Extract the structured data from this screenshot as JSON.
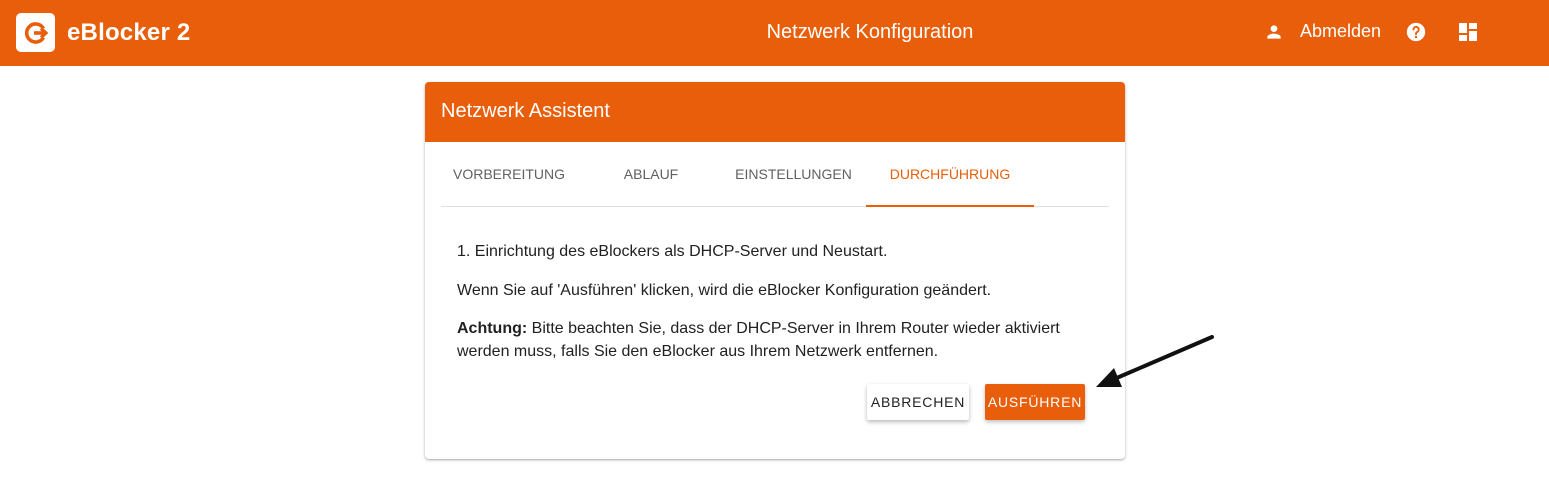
{
  "header": {
    "brand": "eBlocker 2",
    "title": "Netzwerk Konfiguration",
    "logout_label": "Abmelden",
    "icons": [
      "eblocker-logo-icon",
      "user-icon",
      "help-icon",
      "dashboard-icon"
    ],
    "color": "#e95e0a"
  },
  "card": {
    "title": "Netzwerk Assistent",
    "tabs": [
      {
        "label": "VORBEREITUNG",
        "active": false
      },
      {
        "label": "ABLAUF",
        "active": false
      },
      {
        "label": "EINSTELLUNGEN",
        "active": false
      },
      {
        "label": "DURCHFÜHRUNG",
        "active": true
      }
    ],
    "step_text": "1. Einrichtung des eBlockers als DHCP-Server und Neustart.",
    "info_text": "Wenn Sie auf 'Ausführen' klicken, wird die eBlocker Konfiguration geändert.",
    "warning_label": "Achtung:",
    "warning_text": " Bitte beachten Sie, dass der DHCP-Server in Ihrem Router wieder aktiviert werden muss, falls Sie den eBlocker aus Ihrem Netzwerk entfernen.",
    "cancel_label": "ABBRECHEN",
    "run_label": "AUSFÜHREN"
  }
}
